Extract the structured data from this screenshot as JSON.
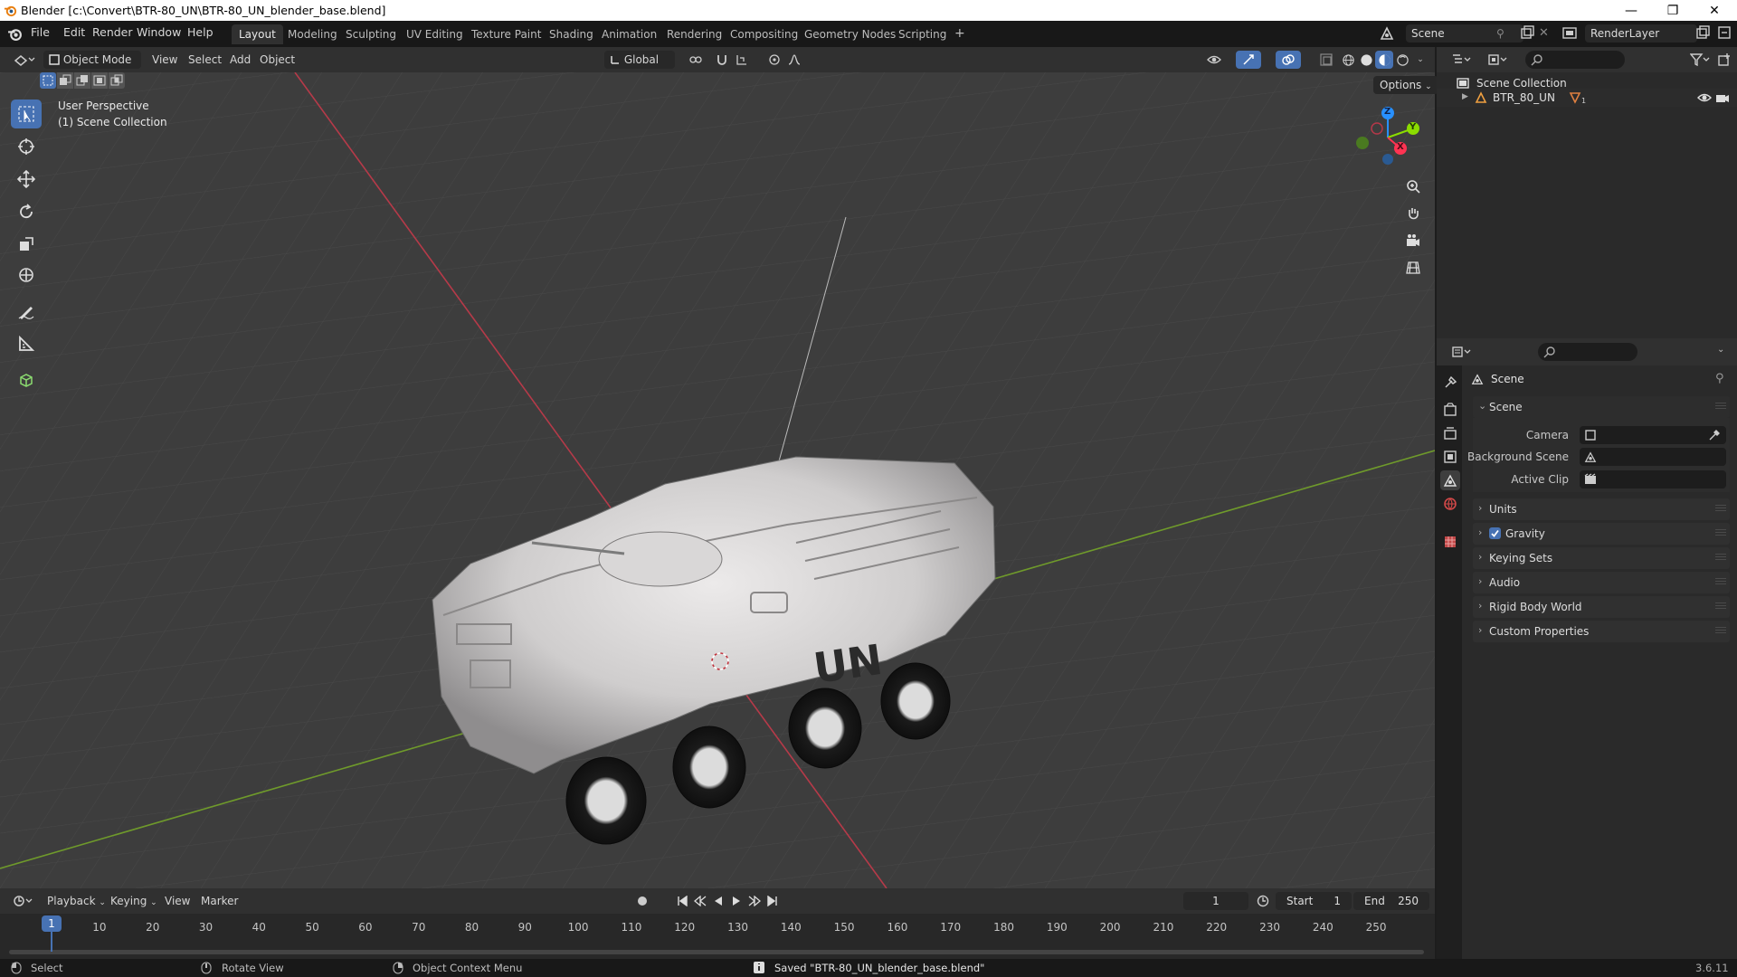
{
  "window": {
    "title": "Blender [c:\\Convert\\BTR-80_UN\\BTR-80_UN_blender_base.blend]",
    "controls": [
      "—",
      "❐",
      "✕"
    ]
  },
  "menus": [
    "File",
    "Edit",
    "Render",
    "Window",
    "Help"
  ],
  "workspaces": {
    "active": "Layout",
    "tabs": [
      "Layout",
      "Modeling",
      "Sculpting",
      "UV Editing",
      "Texture Paint",
      "Shading",
      "Animation",
      "Rendering",
      "Compositing",
      "Geometry Nodes",
      "Scripting"
    ],
    "add": "+"
  },
  "scene_selector": {
    "value": "Scene"
  },
  "layer_selector": {
    "value": "RenderLayer"
  },
  "viewport_header": {
    "mode": "Object Mode",
    "menus": [
      "View",
      "Select",
      "Add",
      "Object"
    ],
    "orientation": "Global",
    "options": "Options"
  },
  "viewport_overlay": {
    "line1": "User Perspective",
    "line2": "(1) Scene Collection",
    "vehicle_marking": "UN"
  },
  "gizmo": {
    "z": "Z",
    "y": "Y",
    "x": "X"
  },
  "outliner": {
    "root": "Scene Collection",
    "items": [
      {
        "label": "BTR_80_UN",
        "modifier_count": "1"
      }
    ]
  },
  "properties": {
    "context_title": "Scene",
    "panels": {
      "scene": {
        "label": "Scene",
        "rows": [
          {
            "label": "Camera"
          },
          {
            "label": "Background Scene"
          },
          {
            "label": "Active Clip"
          }
        ]
      },
      "units": "Units",
      "gravity": {
        "label": "Gravity",
        "checked": true
      },
      "keying_sets": "Keying Sets",
      "audio": "Audio",
      "rigid_body_world": "Rigid Body World",
      "custom_properties": "Custom Properties"
    }
  },
  "timeline": {
    "menus": [
      "Playback",
      "Keying",
      "View",
      "Marker"
    ],
    "current_frame": "1",
    "start_label": "Start",
    "start": "1",
    "end_label": "End",
    "end": "250",
    "ruler": [
      "10",
      "20",
      "30",
      "40",
      "50",
      "60",
      "70",
      "80",
      "90",
      "100",
      "110",
      "120",
      "130",
      "140",
      "150",
      "160",
      "170",
      "180",
      "190",
      "200",
      "210",
      "220",
      "230",
      "240",
      "250"
    ],
    "playhead": "1"
  },
  "statusbar": {
    "select": "Select",
    "rotate": "Rotate View",
    "context_menu": "Object Context Menu",
    "message": "Saved \"BTR-80_UN_blender_base.blend\"",
    "version": "3.6.11"
  },
  "colors": {
    "accent": "#4772b3",
    "x_axis": "#ff3352",
    "y_axis": "#8bdc00",
    "z_axis": "#2890ff",
    "viewport_bg": "#3d3d3d"
  }
}
